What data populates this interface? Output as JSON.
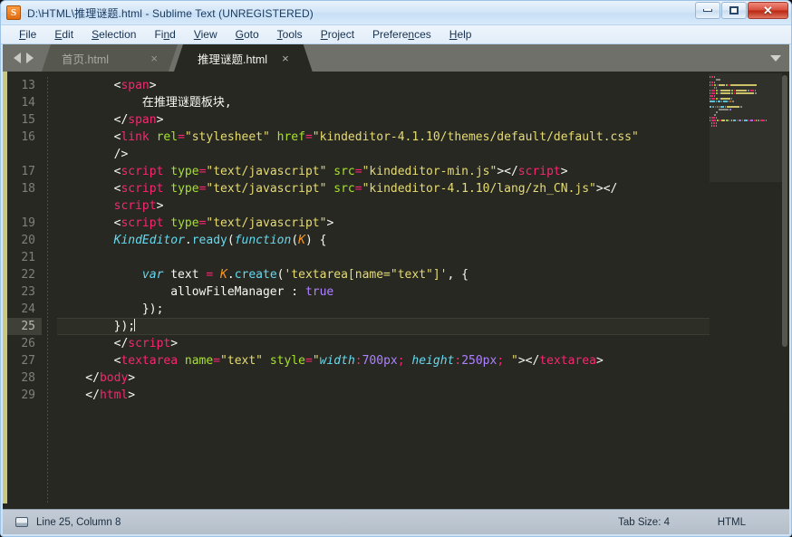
{
  "window": {
    "title": "D:\\HTML\\推理谜题.html - Sublime Text (UNREGISTERED)",
    "app_icon_letter": "S",
    "controls": {
      "minimize": "minimize-icon",
      "maximize": "maximize-icon",
      "close": "✕"
    }
  },
  "menubar": {
    "items": [
      {
        "label": "File",
        "accel": "F"
      },
      {
        "label": "Edit",
        "accel": "E"
      },
      {
        "label": "Selection",
        "accel": "S"
      },
      {
        "label": "Find",
        "accel": "n"
      },
      {
        "label": "View",
        "accel": "V"
      },
      {
        "label": "Goto",
        "accel": "G"
      },
      {
        "label": "Tools",
        "accel": "T"
      },
      {
        "label": "Project",
        "accel": "P"
      },
      {
        "label": "Preferences",
        "accel": "n"
      },
      {
        "label": "Help",
        "accel": "H"
      }
    ]
  },
  "tabbar": {
    "nav_prev": "arrow-left-icon",
    "nav_next": "arrow-right-icon",
    "menu": "chevron-down-icon",
    "tabs": [
      {
        "label": "首页.html",
        "active": false,
        "close": "×"
      },
      {
        "label": "推理谜题.html",
        "active": true,
        "close": "×"
      }
    ]
  },
  "editor": {
    "active_line": 25,
    "gutter": [
      "13",
      "14",
      "15",
      "16",
      "",
      "17",
      "18",
      "",
      "19",
      "20",
      "21",
      "22",
      "23",
      "24",
      "25",
      "26",
      "27",
      "28",
      "29"
    ],
    "lines": [
      {
        "num": "13",
        "tokens": [
          {
            "t": "punc",
            "v": "        "
          },
          {
            "t": "punc",
            "v": "<"
          },
          {
            "t": "tag",
            "v": "span"
          },
          {
            "t": "punc",
            "v": ">"
          }
        ]
      },
      {
        "num": "14",
        "tokens": [
          {
            "t": "plain",
            "v": "            在推理谜题板块,"
          }
        ]
      },
      {
        "num": "15",
        "tokens": [
          {
            "t": "punc",
            "v": "        "
          },
          {
            "t": "punc",
            "v": "</"
          },
          {
            "t": "tag",
            "v": "span"
          },
          {
            "t": "punc",
            "v": ">"
          }
        ]
      },
      {
        "num": "16",
        "tokens": [
          {
            "t": "punc",
            "v": "        "
          },
          {
            "t": "punc",
            "v": "<"
          },
          {
            "t": "tag",
            "v": "link"
          },
          {
            "t": "plain",
            "v": " "
          },
          {
            "t": "attr",
            "v": "rel"
          },
          {
            "t": "op",
            "v": "="
          },
          {
            "t": "str",
            "v": "\"stylesheet\""
          },
          {
            "t": "plain",
            "v": " "
          },
          {
            "t": "attr",
            "v": "href"
          },
          {
            "t": "op",
            "v": "="
          },
          {
            "t": "str",
            "v": "\"kindeditor-4.1.10/themes/default/default.css\""
          }
        ]
      },
      {
        "num": "",
        "tokens": [
          {
            "t": "punc",
            "v": "        /"
          },
          {
            "t": "punc",
            "v": ">"
          }
        ]
      },
      {
        "num": "17",
        "tokens": [
          {
            "t": "punc",
            "v": "        "
          },
          {
            "t": "punc",
            "v": "<"
          },
          {
            "t": "tag",
            "v": "script"
          },
          {
            "t": "plain",
            "v": " "
          },
          {
            "t": "attr",
            "v": "type"
          },
          {
            "t": "op",
            "v": "="
          },
          {
            "t": "str",
            "v": "\"text/javascript\""
          },
          {
            "t": "plain",
            "v": " "
          },
          {
            "t": "attr",
            "v": "src"
          },
          {
            "t": "op",
            "v": "="
          },
          {
            "t": "str",
            "v": "\"kindeditor-min.js\""
          },
          {
            "t": "punc",
            "v": "></"
          },
          {
            "t": "tag",
            "v": "script"
          },
          {
            "t": "punc",
            "v": ">"
          }
        ]
      },
      {
        "num": "18",
        "tokens": [
          {
            "t": "punc",
            "v": "        "
          },
          {
            "t": "punc",
            "v": "<"
          },
          {
            "t": "tag",
            "v": "script"
          },
          {
            "t": "plain",
            "v": " "
          },
          {
            "t": "attr",
            "v": "type"
          },
          {
            "t": "op",
            "v": "="
          },
          {
            "t": "str",
            "v": "\"text/javascript\""
          },
          {
            "t": "plain",
            "v": " "
          },
          {
            "t": "attr",
            "v": "src"
          },
          {
            "t": "op",
            "v": "="
          },
          {
            "t": "str",
            "v": "\"kindeditor-4.1.10/lang/zh_CN.js\""
          },
          {
            "t": "punc",
            "v": "></"
          }
        ]
      },
      {
        "num": "",
        "tokens": [
          {
            "t": "punc",
            "v": "        "
          },
          {
            "t": "tag",
            "v": "script"
          },
          {
            "t": "punc",
            "v": ">"
          }
        ]
      },
      {
        "num": "19",
        "tokens": [
          {
            "t": "punc",
            "v": "        "
          },
          {
            "t": "punc",
            "v": "<"
          },
          {
            "t": "tag",
            "v": "script"
          },
          {
            "t": "plain",
            "v": " "
          },
          {
            "t": "attr",
            "v": "type"
          },
          {
            "t": "op",
            "v": "="
          },
          {
            "t": "str",
            "v": "\"text/javascript\""
          },
          {
            "t": "punc",
            "v": ">"
          }
        ]
      },
      {
        "num": "20",
        "tokens": [
          {
            "t": "punc",
            "v": "        "
          },
          {
            "t": "fn",
            "v": "KindEditor"
          },
          {
            "t": "plain",
            "v": "."
          },
          {
            "t": "meth",
            "v": "ready"
          },
          {
            "t": "plain",
            "v": "("
          },
          {
            "t": "kw",
            "v": "function"
          },
          {
            "t": "plain",
            "v": "("
          },
          {
            "t": "param",
            "v": "K"
          },
          {
            "t": "plain",
            "v": ") {"
          }
        ]
      },
      {
        "num": "21",
        "tokens": [
          {
            "t": "plain",
            "v": ""
          }
        ]
      },
      {
        "num": "22",
        "tokens": [
          {
            "t": "punc",
            "v": "            "
          },
          {
            "t": "kw",
            "v": "var"
          },
          {
            "t": "plain",
            "v": " text "
          },
          {
            "t": "op",
            "v": "="
          },
          {
            "t": "plain",
            "v": " "
          },
          {
            "t": "param",
            "v": "K"
          },
          {
            "t": "plain",
            "v": "."
          },
          {
            "t": "meth",
            "v": "create"
          },
          {
            "t": "plain",
            "v": "("
          },
          {
            "t": "str",
            "v": "'textarea[name=\"text\"]'"
          },
          {
            "t": "plain",
            "v": ", {"
          }
        ]
      },
      {
        "num": "23",
        "tokens": [
          {
            "t": "punc",
            "v": "                allowFileManager : "
          },
          {
            "t": "num",
            "v": "true"
          }
        ]
      },
      {
        "num": "24",
        "tokens": [
          {
            "t": "punc",
            "v": "            });"
          }
        ]
      },
      {
        "num": "25",
        "tokens": [
          {
            "t": "punc",
            "v": "        });"
          }
        ],
        "active": true,
        "caret": true
      },
      {
        "num": "26",
        "tokens": [
          {
            "t": "punc",
            "v": "        "
          },
          {
            "t": "punc",
            "v": "</"
          },
          {
            "t": "tag",
            "v": "script"
          },
          {
            "t": "punc",
            "v": ">"
          }
        ]
      },
      {
        "num": "27",
        "tokens": [
          {
            "t": "punc",
            "v": "        "
          },
          {
            "t": "punc",
            "v": "<"
          },
          {
            "t": "tag",
            "v": "textarea"
          },
          {
            "t": "plain",
            "v": " "
          },
          {
            "t": "attr",
            "v": "name"
          },
          {
            "t": "op",
            "v": "="
          },
          {
            "t": "str",
            "v": "\"text\""
          },
          {
            "t": "plain",
            "v": " "
          },
          {
            "t": "attr",
            "v": "style"
          },
          {
            "t": "op",
            "v": "="
          },
          {
            "t": "str",
            "v": "\""
          },
          {
            "t": "css-prop",
            "v": "width"
          },
          {
            "t": "op",
            "v": ":"
          },
          {
            "t": "num",
            "v": "700px"
          },
          {
            "t": "op",
            "v": ";"
          },
          {
            "t": "plain",
            "v": " "
          },
          {
            "t": "css-prop",
            "v": "height"
          },
          {
            "t": "op",
            "v": ":"
          },
          {
            "t": "num",
            "v": "250px"
          },
          {
            "t": "op",
            "v": ";"
          },
          {
            "t": "str",
            "v": " \""
          },
          {
            "t": "punc",
            "v": "></"
          },
          {
            "t": "tag",
            "v": "textarea"
          },
          {
            "t": "punc",
            "v": ">"
          }
        ]
      },
      {
        "num": "28",
        "tokens": [
          {
            "t": "punc",
            "v": "    </"
          },
          {
            "t": "tag",
            "v": "body"
          },
          {
            "t": "punc",
            "v": ">"
          }
        ]
      },
      {
        "num": "29",
        "tokens": [
          {
            "t": "punc",
            "v": "    </"
          },
          {
            "t": "tag",
            "v": "html"
          },
          {
            "t": "punc",
            "v": ">"
          }
        ]
      }
    ]
  },
  "statusbar": {
    "indicator_icon": "pane-icon",
    "position": "Line 25, Column 8",
    "tab_size": "Tab Size: 4",
    "syntax": "HTML"
  },
  "colors": {
    "editor_bg": "#272822",
    "tagbar_bg": "#6f706a",
    "tag": "#f92672",
    "attr": "#a6e22e",
    "string": "#e6db74",
    "keyword": "#66d9ef",
    "number": "#ae81ff",
    "param": "#fd971f",
    "accent_stripe": "#c9c87d",
    "titlebar": "#d4e6f8",
    "close_button": "#c03a20"
  }
}
